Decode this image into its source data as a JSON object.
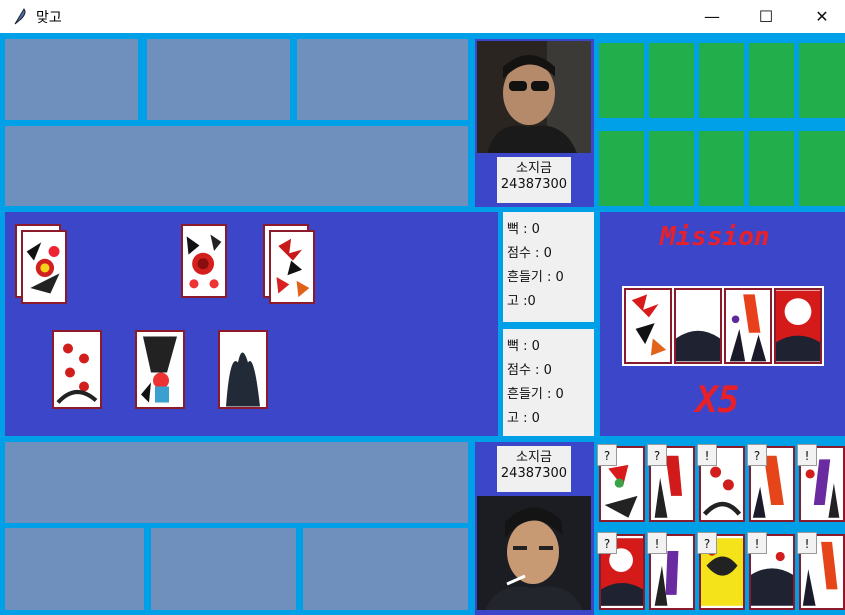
{
  "window": {
    "title": "맞고",
    "minimize": "—",
    "maximize": "☐",
    "close": "✕"
  },
  "opponent": {
    "money_label": "소지금",
    "money_value": "24387300",
    "avatar": "opponent-photo"
  },
  "player": {
    "money_label": "소지금",
    "money_value": "24387300",
    "avatar": "player-photo"
  },
  "opponent_score": {
    "ppuk": "뻑 : 0",
    "score": "점수 : 0",
    "shake": "흔들기 : 0",
    "go": "고 :0"
  },
  "player_score": {
    "ppuk": "뻑 : 0",
    "score": "점수 : 0",
    "shake": "흔들기 : 0",
    "go": "고 : 0"
  },
  "mission": {
    "title": "Mission",
    "multiplier": "X5"
  },
  "hand_marks": {
    "row1": [
      "?",
      "?",
      "!",
      "?",
      "!"
    ],
    "row2": [
      "?",
      "!",
      "?",
      "!",
      "!"
    ]
  },
  "colors": {
    "board": "#00a0e8",
    "felt": "#3c46c8",
    "slot": "#6f8fbc",
    "card_back": "#22ae4a",
    "accent": "#e8202a"
  }
}
